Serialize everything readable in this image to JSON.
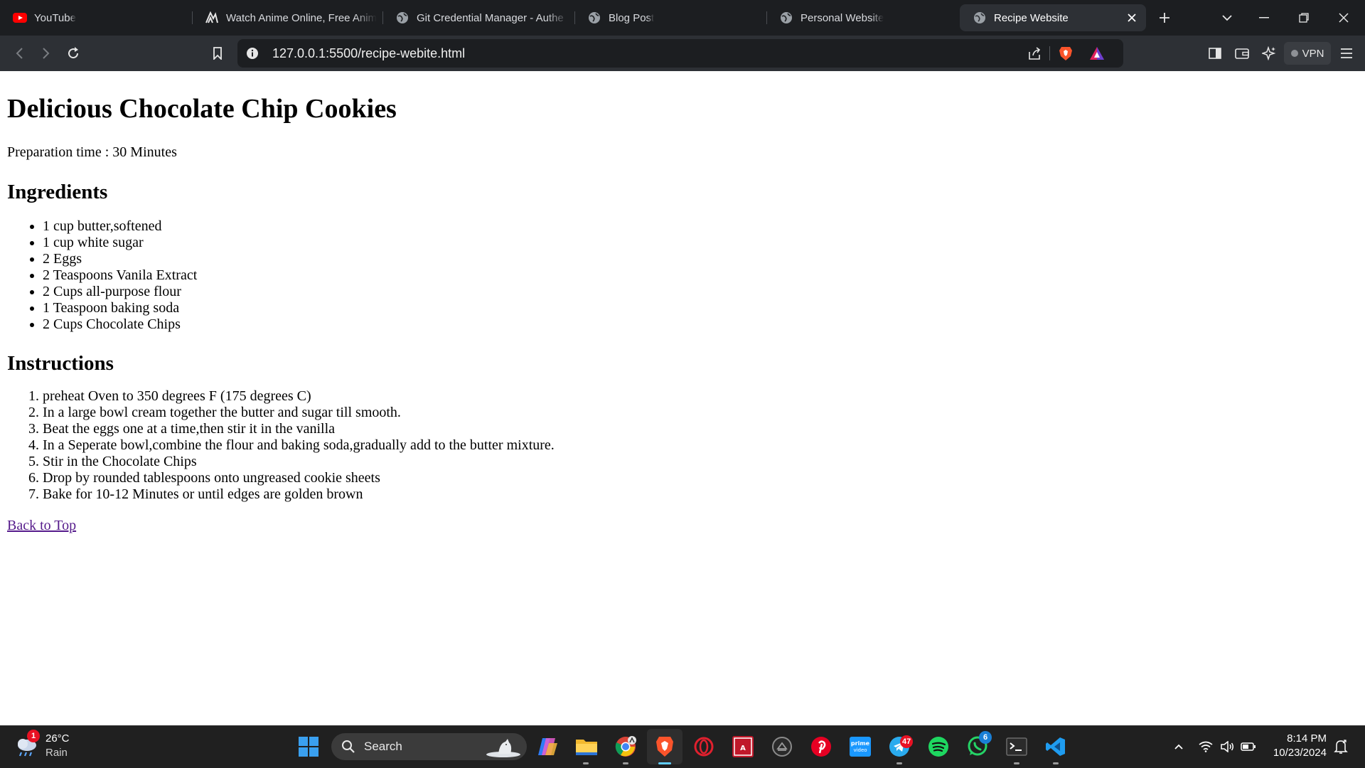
{
  "browser": {
    "tabs": [
      {
        "title": "YouTube",
        "icon": "youtube-icon"
      },
      {
        "title": "Watch Anime Online, Free Anim",
        "icon": "anime-site-icon"
      },
      {
        "title": "Git Credential Manager - Authe",
        "icon": "globe-icon"
      },
      {
        "title": "Blog Post",
        "icon": "globe-icon"
      },
      {
        "title": "Personal Website",
        "icon": "globe-icon"
      },
      {
        "title": "Recipe Website",
        "icon": "globe-icon",
        "active": true
      }
    ],
    "url": "127.0.0.1:5500/recipe-webite.html",
    "vpn_label": "VPN",
    "accent": "#fb542b"
  },
  "page": {
    "title": "Delicious Chocolate Chip Cookies",
    "prep_time": "Preparation time : 30 Minutes",
    "ingredients_heading": "Ingredients",
    "ingredients": [
      "1 cup butter,softened",
      "1 cup white sugar",
      "2 Eggs",
      "2 Teaspoons Vanila Extract",
      "2 Cups all-purpose flour",
      "1 Teaspoon baking soda",
      "2 Cups Chocolate Chips"
    ],
    "instructions_heading": "Instructions",
    "instructions": [
      "preheat Oven to 350 degrees F (175 degrees C)",
      "In a large bowl cream together the butter and sugar till smooth.",
      "Beat the eggs one at a time,then stir it in the vanilla",
      "In a Seperate bowl,combine the flour and baking soda,gradually add to the butter mixture.",
      "Stir in the Chocolate Chips",
      "Drop by rounded tablespoons onto ungreased cookie sheets",
      "Bake for 10-12 Minutes or until edges are golden brown"
    ],
    "back_to_top": "Back to Top"
  },
  "taskbar": {
    "weather_temp": "26°C",
    "weather_condition": "Rain",
    "weather_badge": "1",
    "search_label": "Search",
    "telegram_badge": "47",
    "whatsapp_badge": "6",
    "time": "8:14 PM",
    "date": "10/23/2024"
  }
}
